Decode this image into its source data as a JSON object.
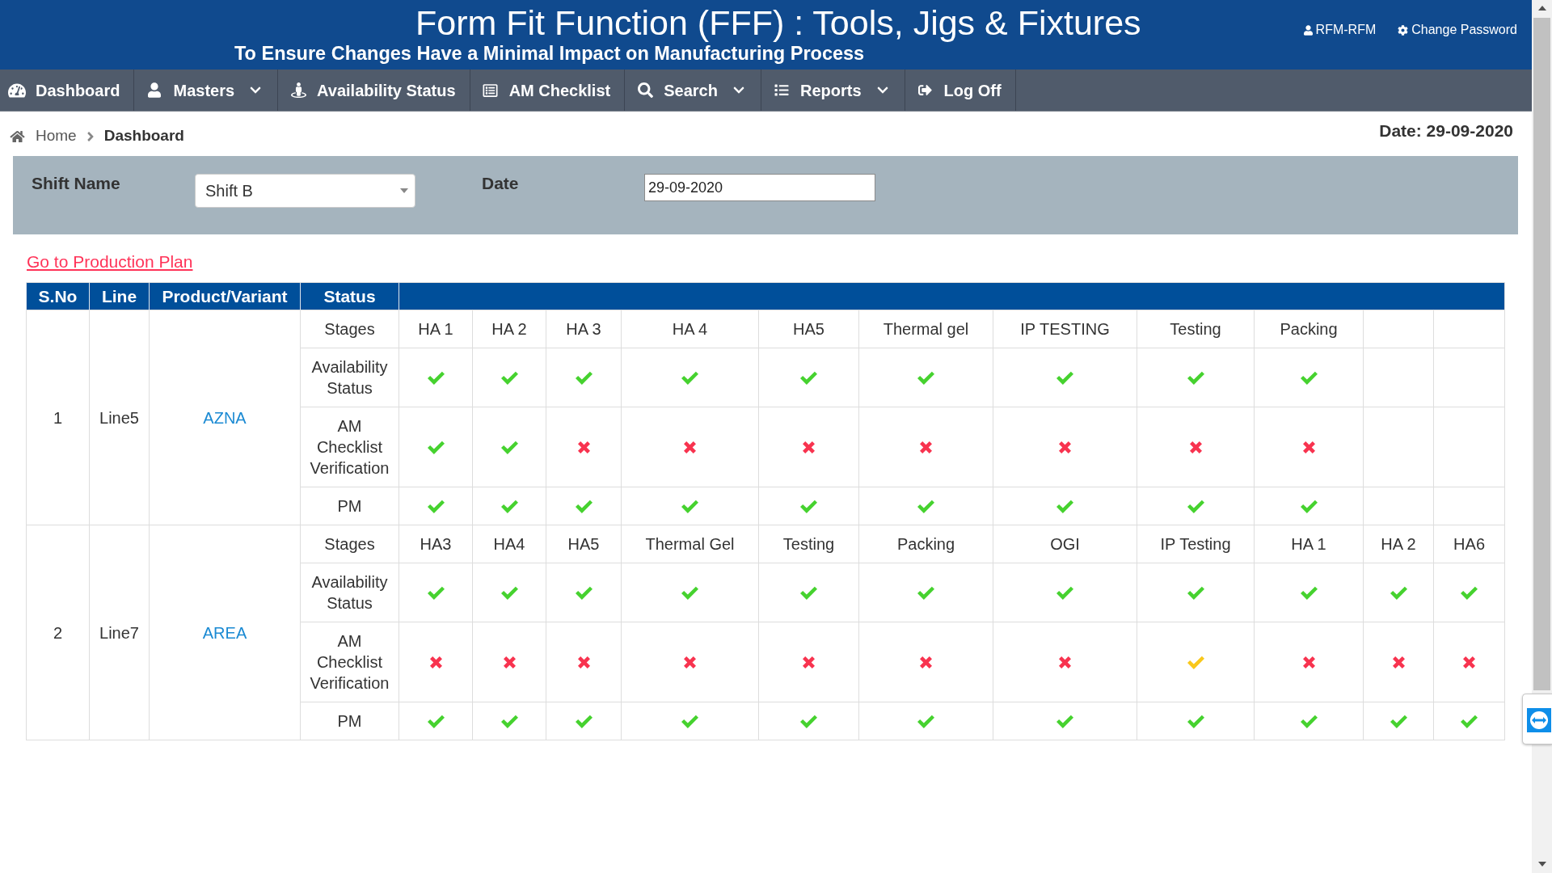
{
  "header": {
    "title": "Form Fit Function (FFF) : Tools, Jigs & Fixtures",
    "subtitle": "To Ensure Changes Have a Minimal Impact on Manufacturing Process",
    "user": "RFM-RFM",
    "change_password": "Change Password"
  },
  "nav": [
    {
      "label": "Dashboard",
      "dropdown": false
    },
    {
      "label": "Masters",
      "dropdown": true
    },
    {
      "label": "Availability Status",
      "dropdown": false
    },
    {
      "label": "AM Checklist",
      "dropdown": false
    },
    {
      "label": "Search",
      "dropdown": true
    },
    {
      "label": "Reports",
      "dropdown": true
    },
    {
      "label": "Log Off",
      "dropdown": false
    }
  ],
  "breadcrumb": [
    {
      "label": "Home",
      "current": false
    },
    {
      "label": "Dashboard",
      "current": true
    }
  ],
  "date_display": "Date: 29-09-2020",
  "filters": {
    "shift_label": "Shift Name",
    "shift_value": "Shift B",
    "date_label": "Date",
    "date_value": "29-09-2020"
  },
  "production_plan_link": "Go to Production Plan",
  "table": {
    "columns": [
      "S.No",
      "Line",
      "Product/Variant",
      "Status"
    ],
    "products": [
      {
        "sno": "1",
        "line": "Line5",
        "variant": "AZNA",
        "row_labels": [
          "Stages",
          "Availability Status",
          "AM Checklist Verification",
          "PM"
        ],
        "stages": [
          {
            "name": "HA 1",
            "availability": {
              "ok": true,
              "color": "#46d22f"
            },
            "am_checklist": {
              "ok": true,
              "color": "#46d22f"
            },
            "pm": {
              "ok": true,
              "color": "#46d22f"
            }
          },
          {
            "name": "HA 2",
            "availability": {
              "ok": true,
              "color": "#46d22f"
            },
            "am_checklist": {
              "ok": true,
              "color": "#46d22f"
            },
            "pm": {
              "ok": true,
              "color": "#46d22f"
            }
          },
          {
            "name": "HA 3",
            "availability": {
              "ok": true,
              "color": "#46d22f"
            },
            "am_checklist": {
              "ok": false,
              "color": "#f8334f"
            },
            "pm": {
              "ok": true,
              "color": "#46d22f"
            }
          },
          {
            "name": "HA 4",
            "availability": {
              "ok": true,
              "color": "#46d22f"
            },
            "am_checklist": {
              "ok": false,
              "color": "#f8334f"
            },
            "pm": {
              "ok": true,
              "color": "#46d22f"
            }
          },
          {
            "name": "HA5",
            "availability": {
              "ok": true,
              "color": "#46d22f"
            },
            "am_checklist": {
              "ok": false,
              "color": "#f8334f"
            },
            "pm": {
              "ok": true,
              "color": "#46d22f"
            }
          },
          {
            "name": "Thermal gel",
            "availability": {
              "ok": true,
              "color": "#46d22f"
            },
            "am_checklist": {
              "ok": false,
              "color": "#f8334f"
            },
            "pm": {
              "ok": true,
              "color": "#46d22f"
            }
          },
          {
            "name": "IP TESTING",
            "availability": {
              "ok": true,
              "color": "#46d22f"
            },
            "am_checklist": {
              "ok": false,
              "color": "#f8334f"
            },
            "pm": {
              "ok": true,
              "color": "#46d22f"
            }
          },
          {
            "name": "Testing",
            "availability": {
              "ok": true,
              "color": "#46d22f"
            },
            "am_checklist": {
              "ok": false,
              "color": "#f8334f"
            },
            "pm": {
              "ok": true,
              "color": "#46d22f"
            }
          },
          {
            "name": "Packing",
            "availability": {
              "ok": true,
              "color": "#46d22f"
            },
            "am_checklist": {
              "ok": false,
              "color": "#f8334f"
            },
            "pm": {
              "ok": true,
              "color": "#46d22f"
            }
          }
        ]
      },
      {
        "sno": "2",
        "line": "Line7",
        "variant": "AREA",
        "row_labels": [
          "Stages",
          "Availability Status",
          "AM Checklist Verification",
          "PM"
        ],
        "stages": [
          {
            "name": "HA3",
            "availability": {
              "ok": true,
              "color": "#46d22f"
            },
            "am_checklist": {
              "ok": false,
              "color": "#f8334f"
            },
            "pm": {
              "ok": true,
              "color": "#46d22f"
            }
          },
          {
            "name": "HA4",
            "availability": {
              "ok": true,
              "color": "#46d22f"
            },
            "am_checklist": {
              "ok": false,
              "color": "#f8334f"
            },
            "pm": {
              "ok": true,
              "color": "#46d22f"
            }
          },
          {
            "name": "HA5",
            "availability": {
              "ok": true,
              "color": "#46d22f"
            },
            "am_checklist": {
              "ok": false,
              "color": "#f8334f"
            },
            "pm": {
              "ok": true,
              "color": "#46d22f"
            }
          },
          {
            "name": "Thermal Gel",
            "availability": {
              "ok": true,
              "color": "#46d22f"
            },
            "am_checklist": {
              "ok": false,
              "color": "#f8334f"
            },
            "pm": {
              "ok": true,
              "color": "#46d22f"
            }
          },
          {
            "name": "Testing",
            "availability": {
              "ok": true,
              "color": "#46d22f"
            },
            "am_checklist": {
              "ok": false,
              "color": "#f8334f"
            },
            "pm": {
              "ok": true,
              "color": "#46d22f"
            }
          },
          {
            "name": "Packing",
            "availability": {
              "ok": true,
              "color": "#46d22f"
            },
            "am_checklist": {
              "ok": false,
              "color": "#f8334f"
            },
            "pm": {
              "ok": true,
              "color": "#46d22f"
            }
          },
          {
            "name": "OGI",
            "availability": {
              "ok": true,
              "color": "#46d22f"
            },
            "am_checklist": {
              "ok": false,
              "color": "#f8334f"
            },
            "pm": {
              "ok": true,
              "color": "#46d22f"
            }
          },
          {
            "name": "IP Testing",
            "availability": {
              "ok": true,
              "color": "#46d22f"
            },
            "am_checklist": {
              "ok": true,
              "color": "#f9c81b"
            },
            "pm": {
              "ok": true,
              "color": "#46d22f"
            }
          },
          {
            "name": "HA 1",
            "availability": {
              "ok": true,
              "color": "#46d22f"
            },
            "am_checklist": {
              "ok": false,
              "color": "#f8334f"
            },
            "pm": {
              "ok": true,
              "color": "#46d22f"
            }
          },
          {
            "name": "HA 2",
            "availability": {
              "ok": true,
              "color": "#46d22f"
            },
            "am_checklist": {
              "ok": false,
              "color": "#f8334f"
            },
            "pm": {
              "ok": true,
              "color": "#46d22f"
            }
          },
          {
            "name": "HA6",
            "availability": {
              "ok": true,
              "color": "#46d22f"
            },
            "am_checklist": {
              "ok": false,
              "color": "#f8334f"
            },
            "pm": {
              "ok": true,
              "color": "#46d22f"
            }
          }
        ]
      }
    ]
  }
}
